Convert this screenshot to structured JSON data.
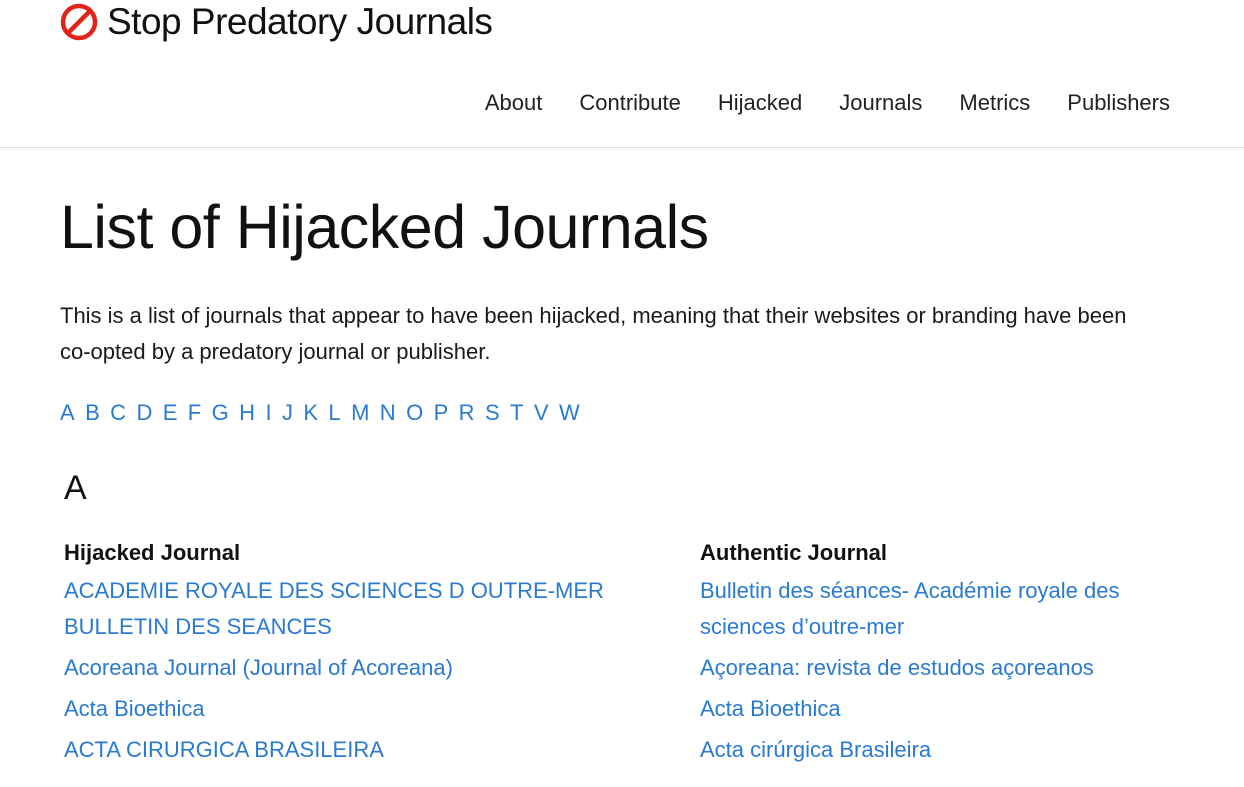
{
  "site": {
    "brand_name": "Stop Predatory Journals",
    "brand_icon": "prohibited-icon",
    "brand_color": "#e2231a"
  },
  "nav": {
    "items": [
      {
        "label": "About"
      },
      {
        "label": "Contribute"
      },
      {
        "label": "Hijacked"
      },
      {
        "label": "Journals"
      },
      {
        "label": "Metrics"
      },
      {
        "label": "Publishers"
      }
    ]
  },
  "page": {
    "title": "List of Hijacked Journals",
    "intro": "This is a list of journals that appear to have been hijacked, meaning that their websites or branding have been co-opted by a predatory journal or publisher.",
    "link_color": "#2a7ad2"
  },
  "letters": [
    "A",
    "B",
    "C",
    "D",
    "E",
    "F",
    "G",
    "H",
    "I",
    "J",
    "K",
    "L",
    "M",
    "N",
    "O",
    "P",
    "R",
    "S",
    "T",
    "V",
    "W"
  ],
  "section": {
    "letter": "A",
    "col_hijacked": "Hijacked Journal",
    "col_authentic": "Authentic Journal",
    "rows": [
      {
        "hijacked": "ACADEMIE ROYALE DES SCIENCES D OUTRE-MER BULLETIN DES SEANCES",
        "authentic": "Bulletin des séances- Académie royale des sciences d’outre-mer"
      },
      {
        "hijacked": "Acoreana Journal (Journal of Acoreana)",
        "authentic": "Açoreana: revista de estudos açoreanos"
      },
      {
        "hijacked": "Acta Bioethica",
        "authentic": "Acta Bioethica"
      },
      {
        "hijacked": "ACTA CIRURGICA BRASILEIRA",
        "authentic": "Acta cirúrgica Brasileira"
      }
    ]
  }
}
